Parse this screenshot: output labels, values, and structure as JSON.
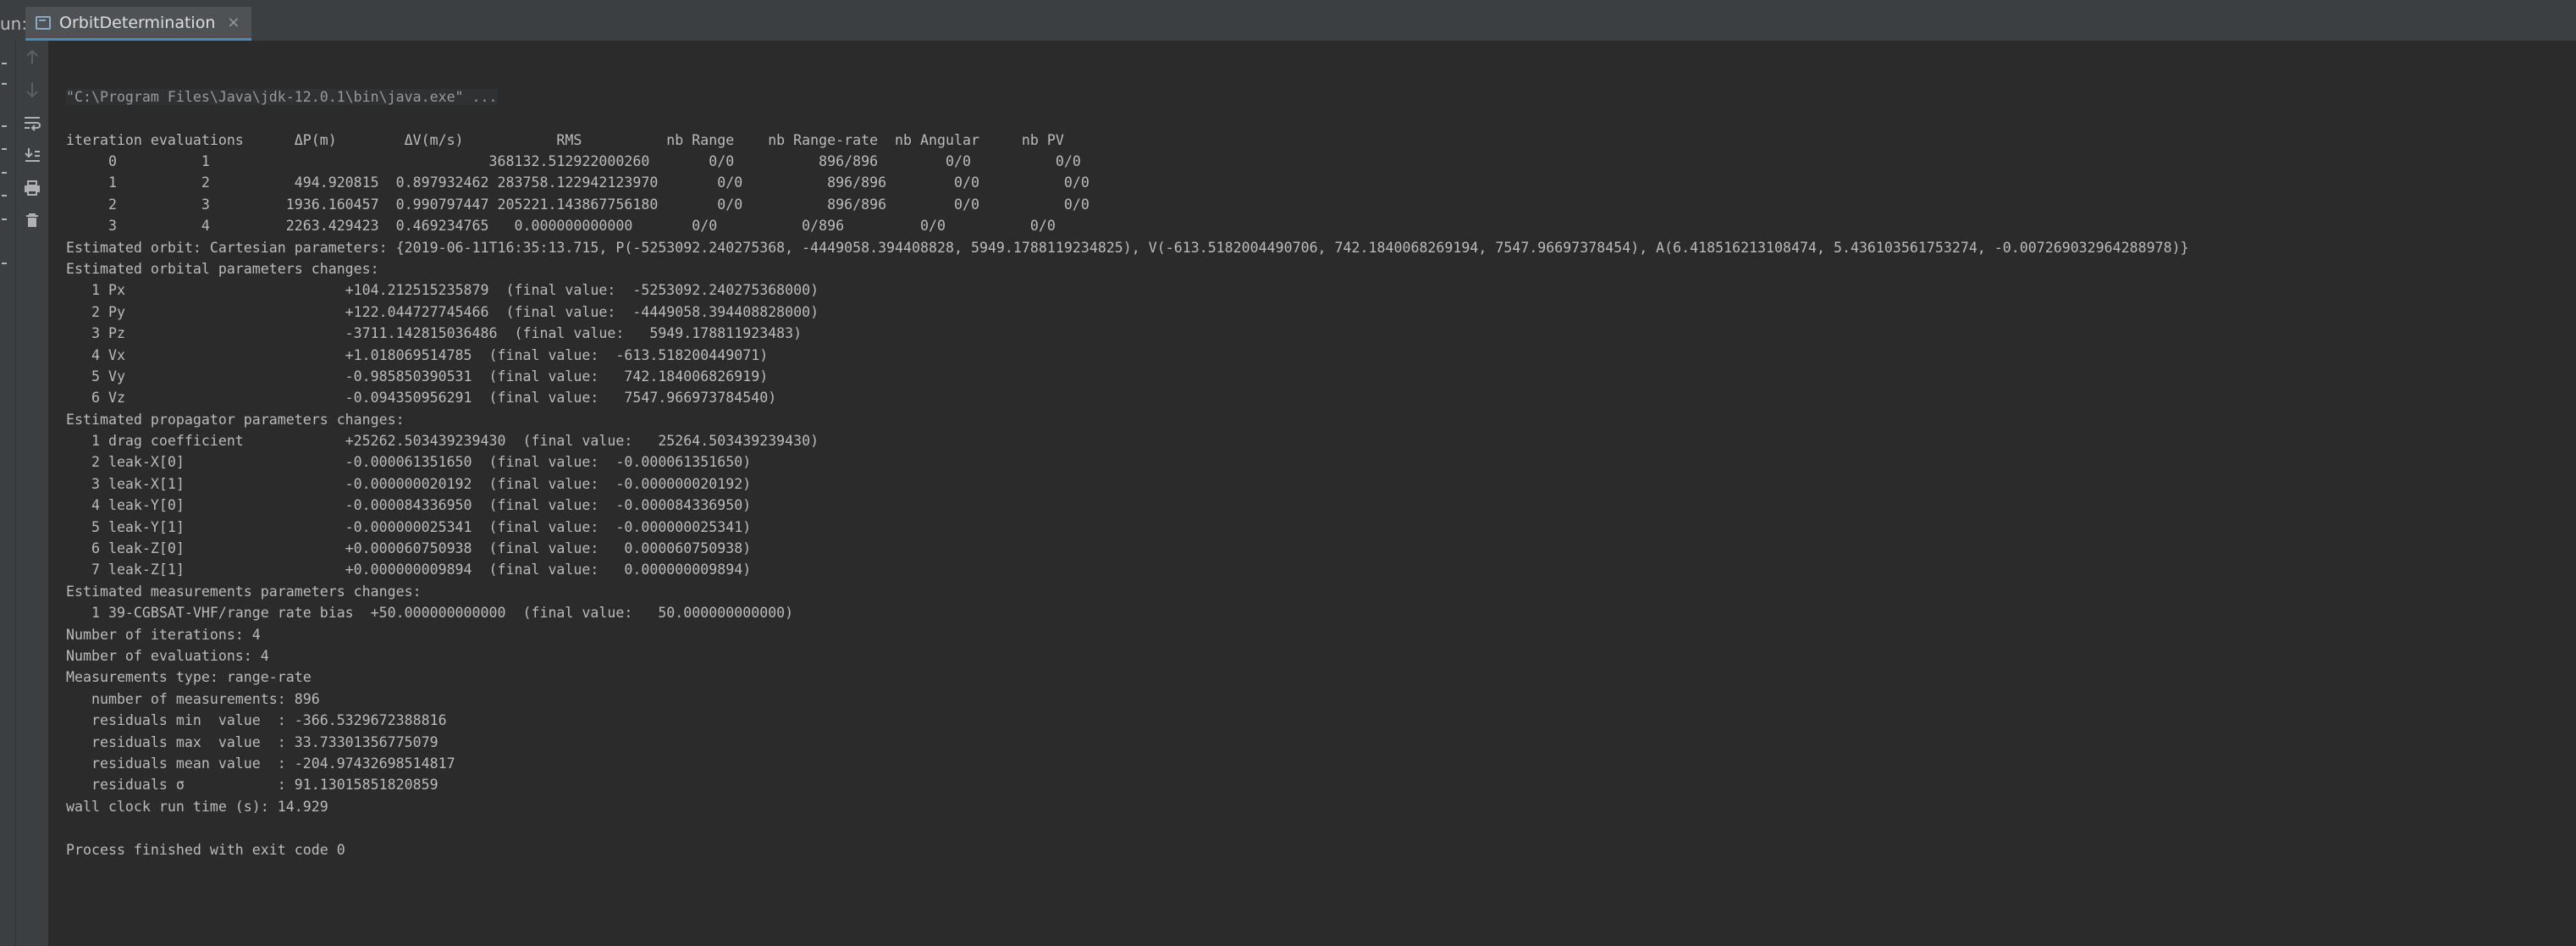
{
  "run_panel": {
    "label": "un:",
    "tab": {
      "title": "OrbitDetermination",
      "close": "×"
    }
  },
  "toolbar": {
    "icons": [
      "up-arrow-icon",
      "down-arrow-icon",
      "soft-wrap-icon",
      "scroll-to-end-icon",
      "print-icon",
      "trash-icon"
    ]
  },
  "console": {
    "command": "\"C:\\Program Files\\Java\\jdk-12.0.1\\bin\\java.exe\" ...",
    "lines": [
      "iteration evaluations      ΔP(m)        ΔV(m/s)           RMS          nb Range    nb Range-rate  nb Angular     nb PV",
      "     0          1                                 368132.512922000260       0/0          896/896        0/0          0/0",
      "     1          2          494.920815  0.897932462 283758.122942123970       0/0          896/896        0/0          0/0",
      "     2          3         1936.160457  0.990797447 205221.143867756180       0/0          896/896        0/0          0/0",
      "     3          4         2263.429423  0.469234765   0.000000000000       0/0          0/896         0/0          0/0",
      "Estimated orbit: Cartesian parameters: {2019-06-11T16:35:13.715, P(-5253092.240275368, -4449058.394408828, 5949.1788119234825), V(-613.5182004490706, 742.1840068269194, 7547.96697378454), A(6.418516213108474, 5.436103561753274, -0.007269032964288978)}",
      "Estimated orbital parameters changes:",
      "   1 Px                          +104.212515235879  (final value:  -5253092.240275368000)",
      "   2 Py                          +122.044727745466  (final value:  -4449058.394408828000)",
      "   3 Pz                          -3711.142815036486  (final value:   5949.178811923483)",
      "   4 Vx                          +1.018069514785  (final value:  -613.518200449071)",
      "   5 Vy                          -0.985850390531  (final value:   742.184006826919)",
      "   6 Vz                          -0.094350956291  (final value:   7547.966973784540)",
      "Estimated propagator parameters changes:",
      "   1 drag coefficient            +25262.503439239430  (final value:   25264.503439239430)",
      "   2 leak-X[0]                   -0.000061351650  (final value:  -0.000061351650)",
      "   3 leak-X[1]                   -0.000000020192  (final value:  -0.000000020192)",
      "   4 leak-Y[0]                   -0.000084336950  (final value:  -0.000084336950)",
      "   5 leak-Y[1]                   -0.000000025341  (final value:  -0.000000025341)",
      "   6 leak-Z[0]                   +0.000060750938  (final value:   0.000060750938)",
      "   7 leak-Z[1]                   +0.000000009894  (final value:   0.000000009894)",
      "Estimated measurements parameters changes:",
      "   1 39-CGBSAT-VHF/range rate bias  +50.000000000000  (final value:   50.000000000000)",
      "Number of iterations: 4",
      "Number of evaluations: 4",
      "Measurements type: range-rate",
      "   number of measurements: 896",
      "   residuals min  value  : -366.5329672388816",
      "   residuals max  value  : 33.73301356775079",
      "   residuals mean value  : -204.97432698514817",
      "   residuals σ           : 91.13015851820859",
      "wall clock run time (s): 14.929",
      "",
      "Process finished with exit code 0"
    ]
  }
}
